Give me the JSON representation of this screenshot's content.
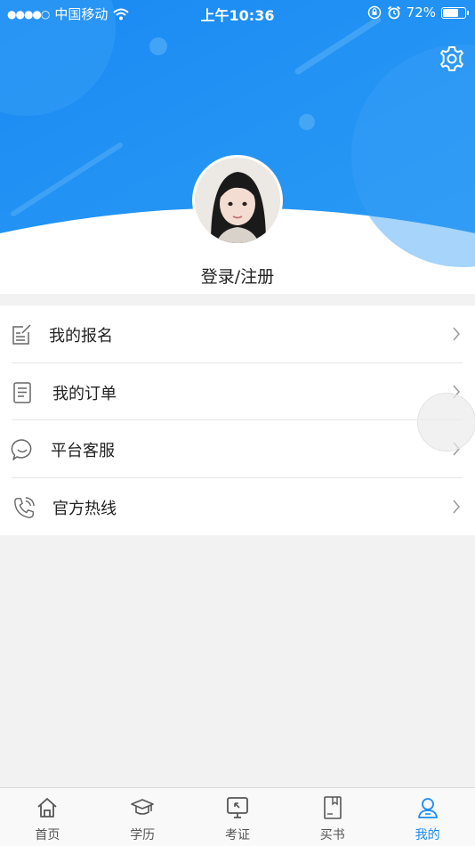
{
  "status_bar": {
    "signal": "●●●●○",
    "carrier": "中国移动",
    "time": "上午10:36",
    "battery": "72%",
    "battery_level": 0.72
  },
  "profile": {
    "login_label": "登录/注册"
  },
  "menu": {
    "items": [
      {
        "label": "我的报名",
        "icon": "edit-note-icon"
      },
      {
        "label": "我的订单",
        "icon": "order-document-icon"
      },
      {
        "label": "平台客服",
        "icon": "chat-bubble-icon"
      },
      {
        "label": "官方热线",
        "icon": "phone-icon"
      }
    ]
  },
  "tabbar": {
    "items": [
      {
        "label": "首页",
        "icon": "home-icon"
      },
      {
        "label": "学历",
        "icon": "graduation-cap-icon"
      },
      {
        "label": "考证",
        "icon": "certificate-monitor-icon"
      },
      {
        "label": "买书",
        "icon": "book-icon"
      },
      {
        "label": "我的",
        "icon": "user-icon"
      }
    ],
    "active_index": 4
  },
  "colors": {
    "brand_blue": "#1b8cf2",
    "header_blue": "#1e8ff4",
    "background": "#f2f2f2"
  }
}
